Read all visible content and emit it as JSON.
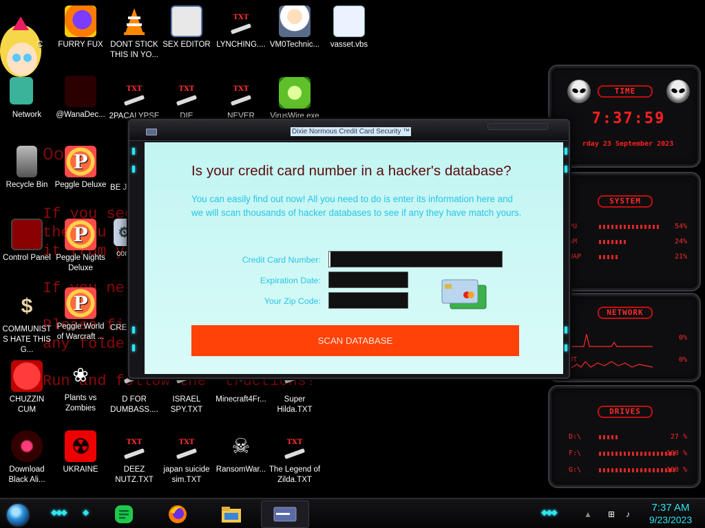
{
  "wallpaper_lines": [
    "Oooo",
    "If you see",
    "the you",
    "it from y",
    "If you ne",
    "Please fi",
    "any folde",
    "Run and follow the  tructions!"
  ],
  "desktop_icons": [
    {
      "label": "C",
      "icon": "character-art"
    },
    {
      "label": "FURRY FUX",
      "icon": "firefox-icon"
    },
    {
      "label": "DONT STICK THIS IN YO...",
      "icon": "vlc-cone-icon"
    },
    {
      "label": "SEX EDITOR",
      "icon": "webpage-icon"
    },
    {
      "label": "LYNCHING....",
      "icon": "txt-file-icon"
    },
    {
      "label": "VM0Technic...",
      "icon": "doctor-avatar-icon"
    },
    {
      "label": "vasset.vbs",
      "icon": "script-file-icon"
    },
    {
      "label": "Network",
      "icon": "network-icon"
    },
    {
      "label": "@WanaDec...",
      "icon": "wanadecryptor-icon"
    },
    {
      "label": "2PACALYPSE 2.3",
      "icon": "txt-file-icon"
    },
    {
      "label": "DIE",
      "icon": "txt-file-icon"
    },
    {
      "label": "NEVER",
      "icon": "txt-file-icon"
    },
    {
      "label": "VirusWire.exe",
      "icon": "lime-icon"
    },
    {
      "label": "Recycle Bin",
      "icon": "recycle-bin-icon"
    },
    {
      "label": "Peggle Deluxe",
      "icon": "peggle-icon"
    },
    {
      "label": "BE JU THE D",
      "icon": "txt-file-icon"
    },
    {
      "label": "Control Panel",
      "icon": "control-panel-icon"
    },
    {
      "label": "Peggle Nights Deluxe",
      "icon": "peggle-icon"
    },
    {
      "label": "com",
      "icon": "gear-document-icon"
    },
    {
      "label": "COMMUNISTS HATE THIS G...",
      "icon": "money-bag-icon"
    },
    {
      "label": "Peggle World of Warcraft ...",
      "icon": "peggle-icon"
    },
    {
      "label": "CRED CHEC",
      "icon": "txt-file-icon"
    },
    {
      "label": "CHUZZIN CUM",
      "icon": "chuzzle-icon"
    },
    {
      "label": "Plants vs Zombies",
      "icon": "plants-icon"
    },
    {
      "label": "D FOR DUMBASS....",
      "icon": "txt-file-icon"
    },
    {
      "label": "ISRAEL SPY.TXT",
      "icon": "txt-file-icon"
    },
    {
      "label": "Minecraft4Fr...",
      "icon": "minecraft-icon"
    },
    {
      "label": "Super Hilda.TXT",
      "icon": "txt-file-icon"
    },
    {
      "label": "Download Black Ali...",
      "icon": "black-orb-icon"
    },
    {
      "label": "UKRAINE",
      "icon": "radiation-icon"
    },
    {
      "label": "DEEZ NUTZ.TXT",
      "icon": "txt-file-icon"
    },
    {
      "label": "japan suicide sim.TXT",
      "icon": "txt-file-icon"
    },
    {
      "label": "RansomWar...",
      "icon": "skull-icon"
    },
    {
      "label": "The Legend of Zilda.TXT",
      "icon": "txt-file-icon"
    }
  ],
  "txt_badge": "TXT",
  "gadgets": {
    "time": {
      "title": "TIME",
      "clock": "7:37:59",
      "date": "rday 23 September 2023"
    },
    "system": {
      "title": "SYSTEM",
      "rows": [
        {
          "label": "PU",
          "value": "54%"
        },
        {
          "label": "AM",
          "value": "24%"
        },
        {
          "label": "WAP",
          "value": "21%"
        }
      ]
    },
    "network": {
      "title": "NETWORK",
      "rows": [
        {
          "label": "",
          "value": "0%"
        },
        {
          "label": "UT",
          "value": "0%"
        }
      ]
    },
    "drives": {
      "title": "DRIVES",
      "rows": [
        {
          "label": "D:\\",
          "value": "27 %"
        },
        {
          "label": "F:\\",
          "value": "100 %"
        },
        {
          "label": "G:\\",
          "value": "100 %"
        }
      ]
    }
  },
  "dialog": {
    "title": "Dixie Normous Credit Card Security ™",
    "heading": "Is your credit card number in a hacker's database?",
    "description": "You can easily find out now! All you need to do is enter its information here and we will scan thousands of hacker databases to see if any they have match yours.",
    "fields": {
      "card_number_label": "Credit Card Number:",
      "card_number_value": "",
      "expiration_label": "Expiration Date:",
      "expiration_value": "",
      "zip_label": "Your Zip Code:",
      "zip_value": ""
    },
    "scan_button": "SCAN DATABASE"
  },
  "taskbar": {
    "apps": [
      "start-orb",
      "feedback-hub",
      "firefox",
      "file-explorer",
      "credit-card-app"
    ],
    "time": "7:37 AM",
    "date": "9/23/2023"
  },
  "colors": {
    "dialog_bg": "#c2f5f2",
    "heading": "#5a0b0b",
    "accent_text": "#27c4e8",
    "scan_button": "#ff4308",
    "gadget_red": "#ff2b2b",
    "taskbar_cyan": "#2ee6f2"
  }
}
